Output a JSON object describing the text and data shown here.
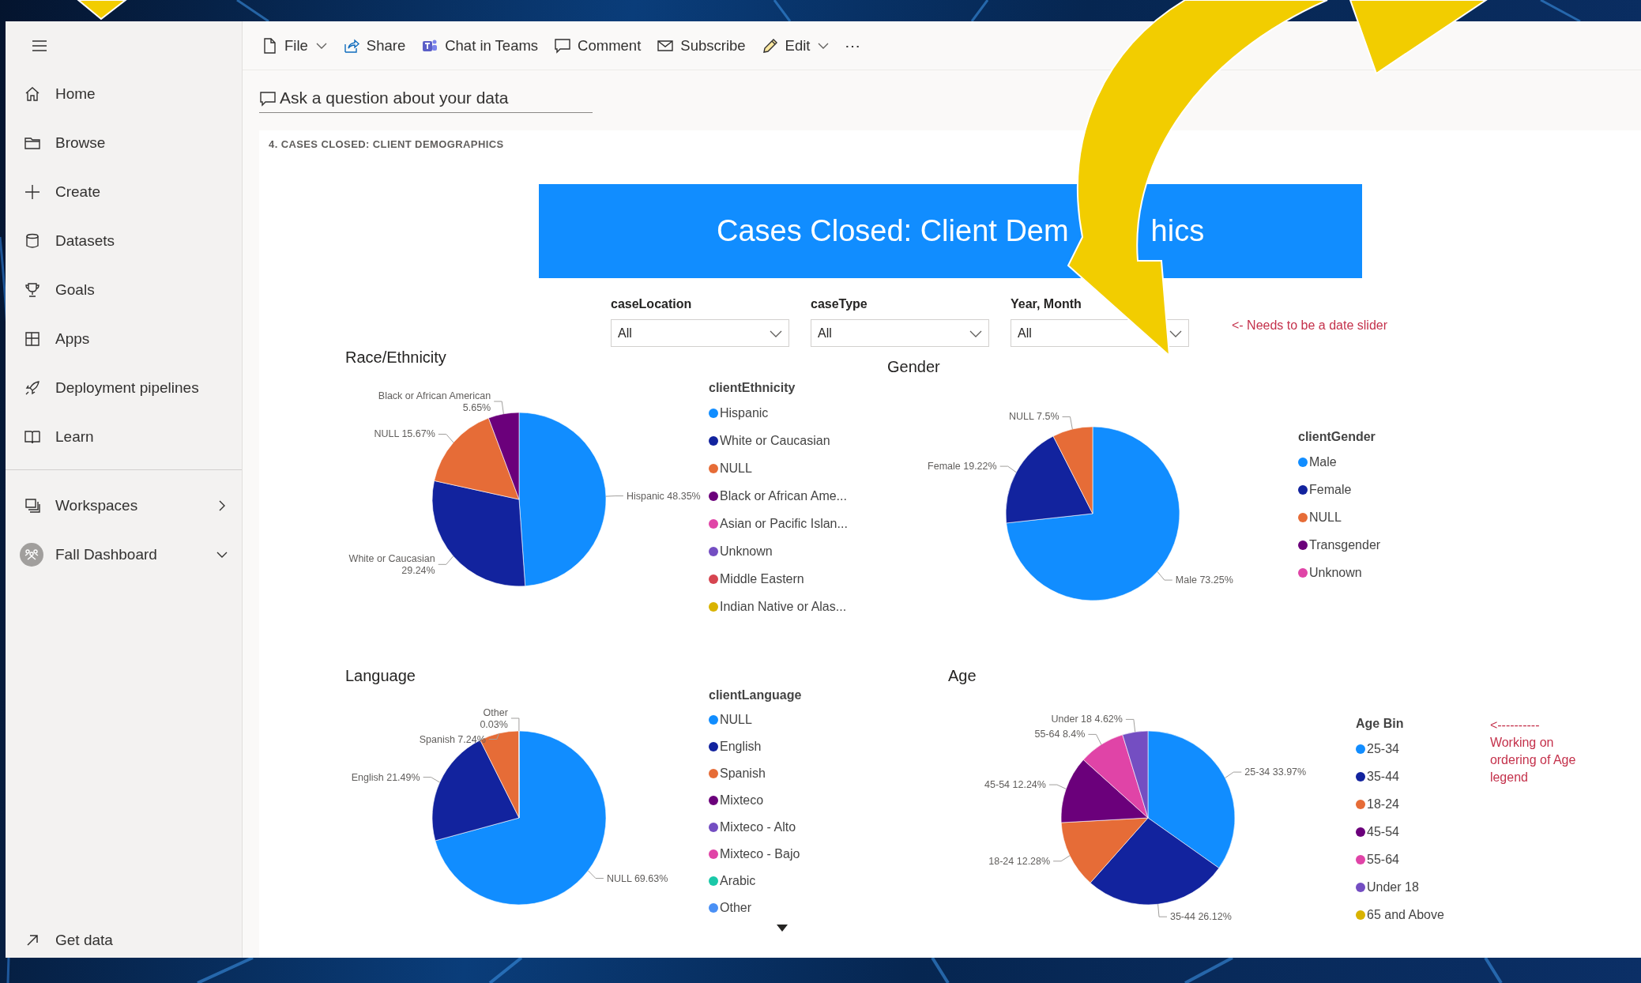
{
  "sidebar": {
    "nav_items": [
      {
        "label": "Home"
      },
      {
        "label": "Browse"
      },
      {
        "label": "Create"
      },
      {
        "label": "Datasets"
      },
      {
        "label": "Goals"
      },
      {
        "label": "Apps"
      },
      {
        "label": "Deployment pipelines"
      },
      {
        "label": "Learn"
      }
    ],
    "workspace_items": [
      {
        "label": "Workspaces",
        "expanded": false
      },
      {
        "label": "Fall Dashboard",
        "expanded": true
      }
    ],
    "footer_item": {
      "label": "Get data"
    }
  },
  "toolbar": {
    "items": [
      {
        "label": "File",
        "dropdown": true
      },
      {
        "label": "Share",
        "dropdown": false
      },
      {
        "label": "Chat in Teams",
        "dropdown": false
      },
      {
        "label": "Comment",
        "dropdown": false
      },
      {
        "label": "Subscribe",
        "dropdown": false
      },
      {
        "label": "Edit",
        "dropdown": true
      }
    ],
    "more": "⋯"
  },
  "ask_field": {
    "placeholder": "Ask a question about your data"
  },
  "page_label": "4. CASES CLOSED: CLIENT DEMOGRAPHICS",
  "banner": {
    "title_parts": [
      "Cases Closed: Client Dem",
      "hics"
    ]
  },
  "filters": [
    {
      "label": "caseLocation",
      "value": "All"
    },
    {
      "label": "caseType",
      "value": "All"
    },
    {
      "label": "Year, Month",
      "value": "All"
    }
  ],
  "filter_note": "<- Needs to be a date slider",
  "charts": [
    {
      "title": "Race/Ethnicity",
      "legend_title": "clientEthnicity",
      "chart_data": {
        "type": "pie",
        "categories": [
          "Hispanic",
          "White or Caucasian",
          "NULL",
          "Black or African Ame...",
          "Asian or Pacific Islan...",
          "Unknown",
          "Middle Eastern",
          "Indian Native or Alas..."
        ],
        "values": [
          48.35,
          29.24,
          15.67,
          5.65,
          null,
          null,
          null,
          null
        ],
        "value_labels": [
          "Hispanic 48.35%",
          "White or Caucasian\n29.24%",
          "NULL 15.67%",
          "Black or African American\n5.65%",
          null,
          null,
          null,
          null
        ],
        "colors": [
          "#118dff",
          "#12239e",
          "#e66c37",
          "#6b007b",
          "#e044a7",
          "#744ec2",
          "#d64550",
          "#d9b300"
        ]
      }
    },
    {
      "title": "Gender",
      "legend_title": "clientGender",
      "chart_data": {
        "type": "pie",
        "categories": [
          "Male",
          "Female",
          "NULL",
          "Transgender",
          "Unknown"
        ],
        "values": [
          73.25,
          19.22,
          7.5,
          null,
          null
        ],
        "value_labels": [
          "Male 73.25%",
          "Female 19.22%",
          "NULL 7.5%",
          null,
          null
        ],
        "colors": [
          "#118dff",
          "#12239e",
          "#e66c37",
          "#6b007b",
          "#e044a7"
        ]
      }
    },
    {
      "title": "Language",
      "legend_title": "clientLanguage",
      "chart_data": {
        "type": "pie",
        "categories": [
          "NULL",
          "English",
          "Spanish",
          "Mixteco",
          "Mixteco - Alto",
          "Mixteco - Bajo",
          "Arabic",
          "Other"
        ],
        "values": [
          69.63,
          21.49,
          7.24,
          null,
          null,
          null,
          null,
          0.03
        ],
        "value_labels": [
          "NULL 69.63%",
          "English 21.49%",
          "Spanish 7.24%",
          null,
          null,
          null,
          null,
          "Other\n0.03%"
        ],
        "colors": [
          "#118dff",
          "#12239e",
          "#e66c37",
          "#6b007b",
          "#744ec2",
          "#e044a7",
          "#1ac8a8",
          "#4a90f5"
        ]
      }
    },
    {
      "title": "Age",
      "legend_title": "Age Bin",
      "chart_data": {
        "type": "pie",
        "categories": [
          "25-34",
          "35-44",
          "18-24",
          "45-54",
          "55-64",
          "Under 18",
          "65 and Above"
        ],
        "values": [
          33.97,
          26.12,
          12.28,
          12.24,
          8.4,
          4.62,
          null
        ],
        "value_labels": [
          "25-34 33.97%",
          "35-44 26.12%",
          "18-24 12.28%",
          "45-54 12.24%",
          "55-64 8.4%",
          "Under 18 4.62%",
          null
        ],
        "colors": [
          "#118dff",
          "#12239e",
          "#e66c37",
          "#6b007b",
          "#e044a7",
          "#744ec2",
          "#d9b300"
        ]
      }
    }
  ],
  "age_note": {
    "arrow": "<----------",
    "text": "Working on ordering of Age legend"
  }
}
